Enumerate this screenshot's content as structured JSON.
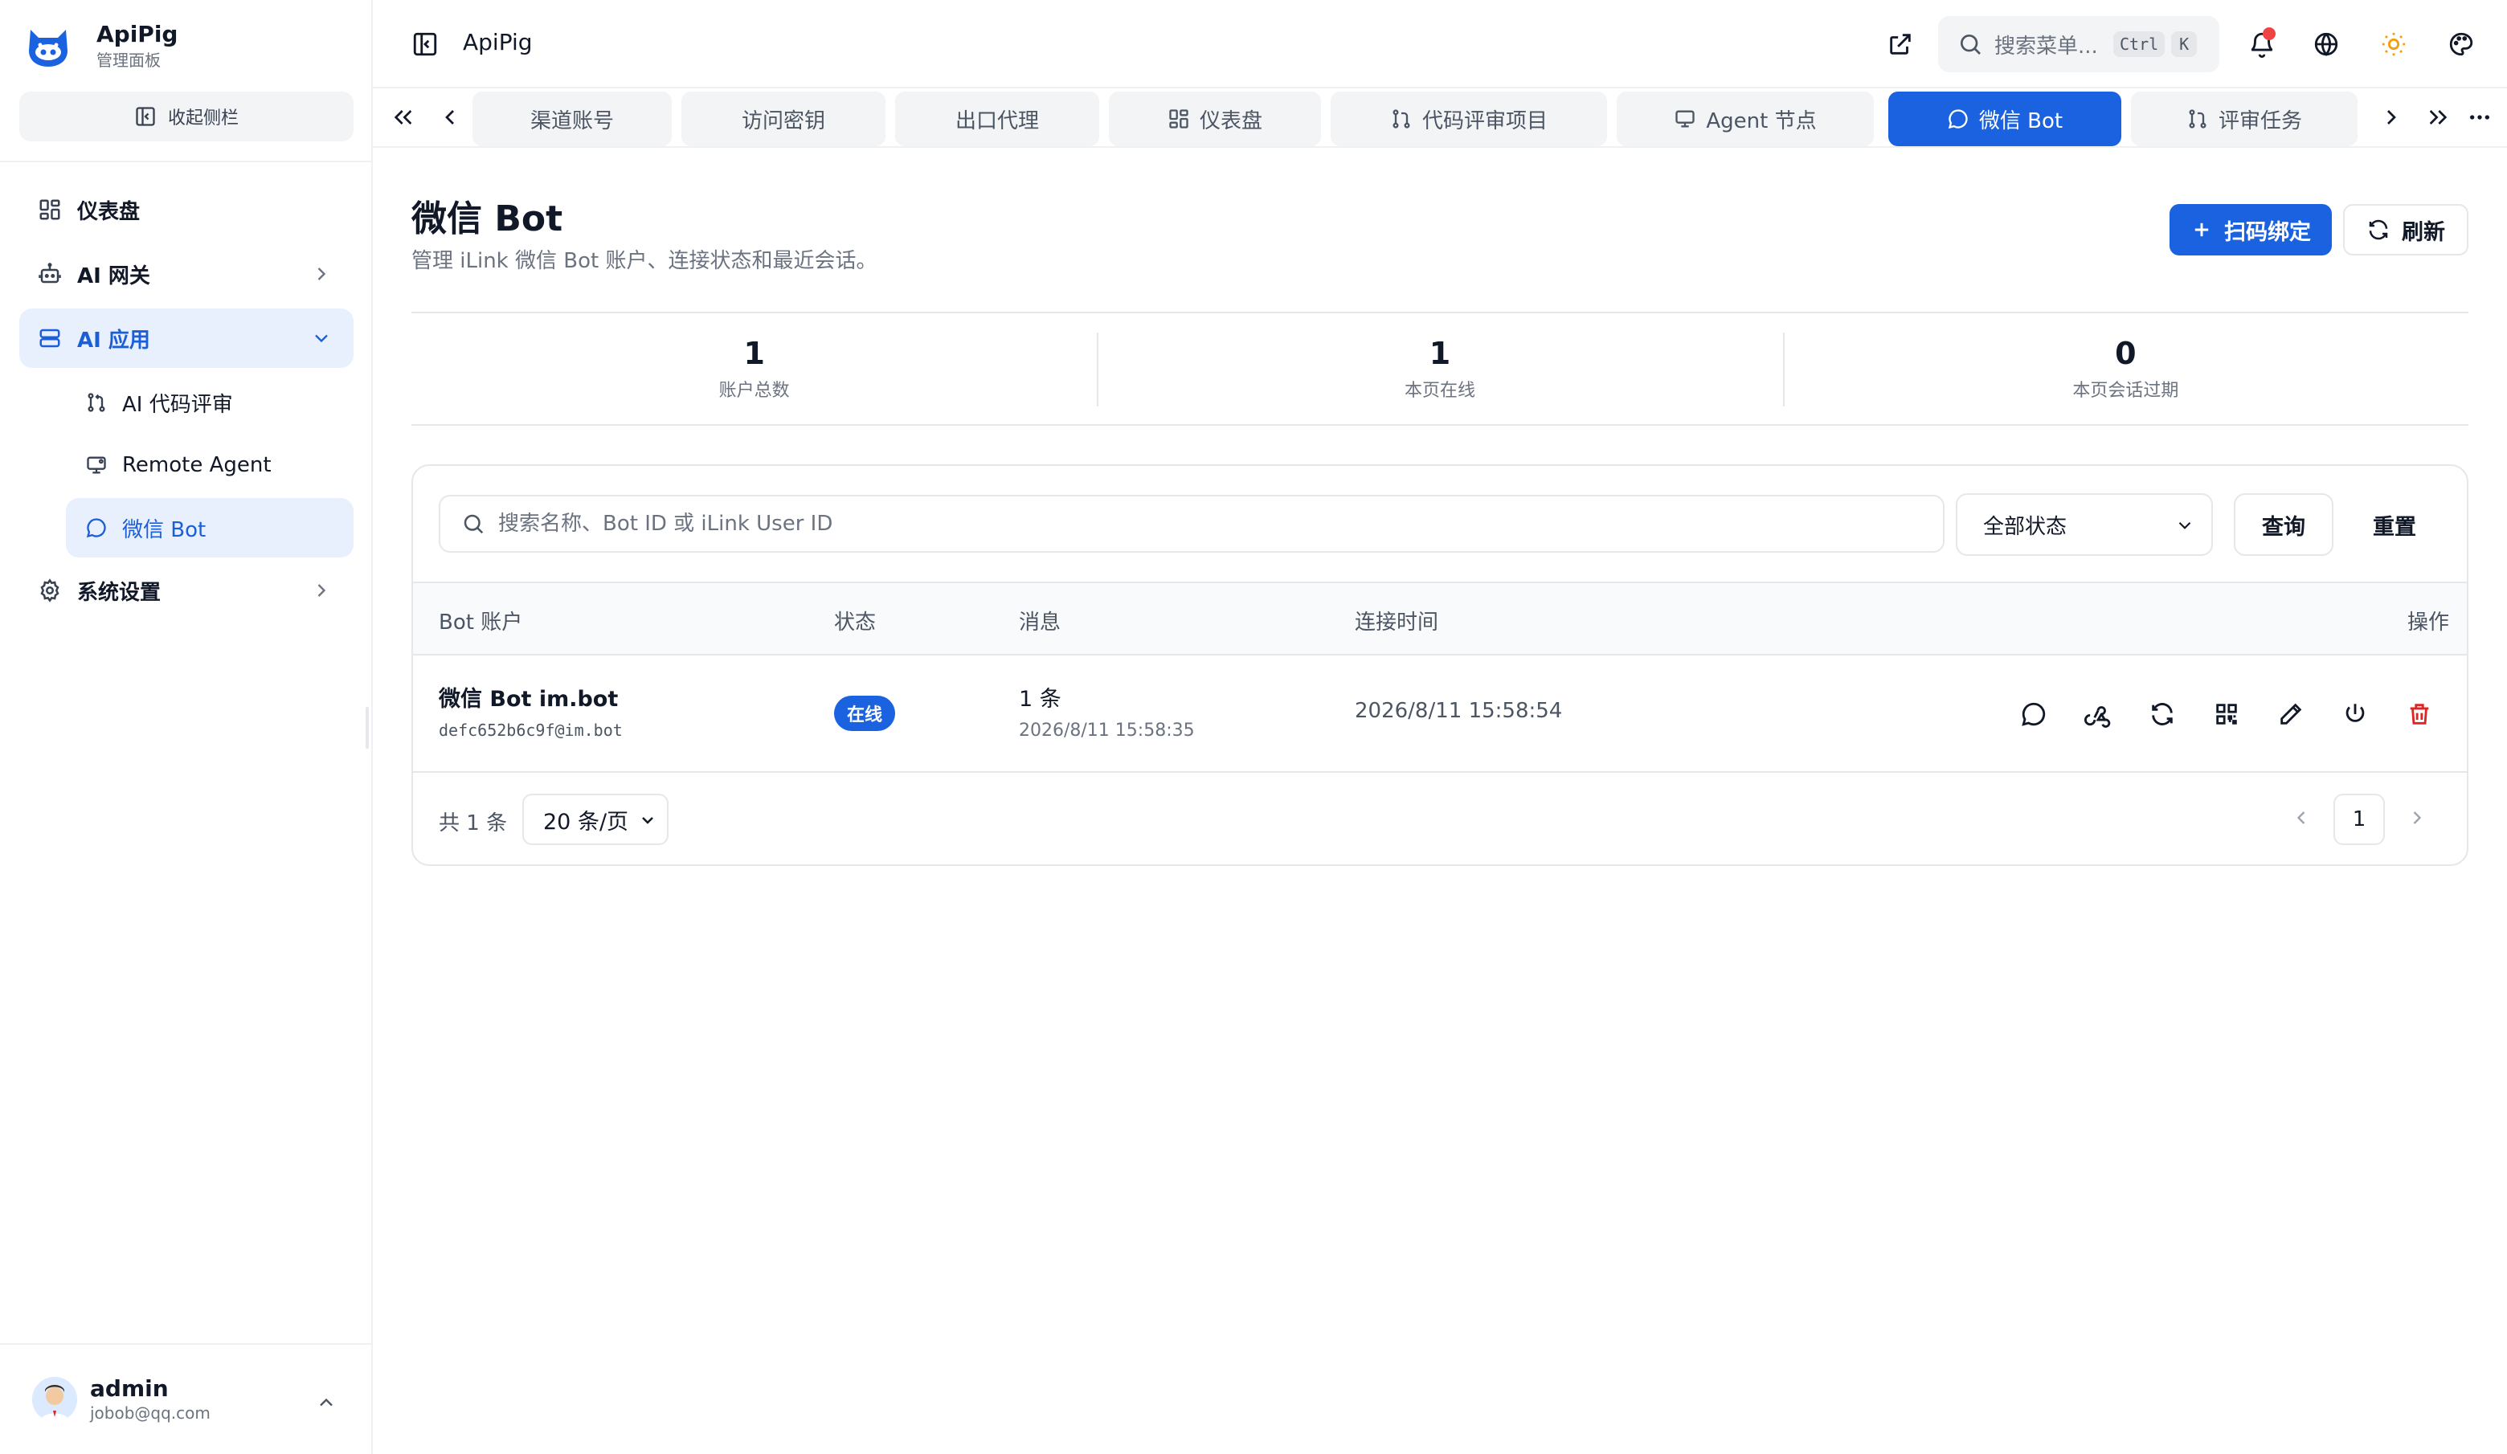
{
  "brand": {
    "title": "ApiPig",
    "subtitle": "管理面板"
  },
  "sidebar": {
    "collapse_label": "收起侧栏",
    "items": [
      {
        "label": "仪表盘",
        "icon": "dashboard-icon"
      },
      {
        "label": "AI 网关",
        "icon": "robot-icon"
      },
      {
        "label": "AI 应用",
        "icon": "server-icon"
      },
      {
        "label": "系统设置",
        "icon": "gear-icon"
      }
    ],
    "sub_items": [
      {
        "label": "AI 代码评审",
        "icon": "git-pull-request-icon"
      },
      {
        "label": "Remote Agent",
        "icon": "monitor-icon"
      },
      {
        "label": "微信 Bot",
        "icon": "chat-bubble-icon"
      }
    ]
  },
  "user": {
    "name": "admin",
    "email": "jobob@qq.com"
  },
  "topbar": {
    "title": "ApiPig",
    "search_placeholder": "搜索菜单...",
    "kbd_ctrl": "Ctrl",
    "kbd_k": "K"
  },
  "tabs": [
    {
      "label": "渠道账号"
    },
    {
      "label": "访问密钥"
    },
    {
      "label": "出口代理"
    },
    {
      "label": "仪表盘"
    },
    {
      "label": "代码评审项目"
    },
    {
      "label": "Agent 节点"
    },
    {
      "label": "微信 Bot"
    },
    {
      "label": "评审任务"
    }
  ],
  "page": {
    "title": "微信 Bot",
    "description": "管理 iLink 微信 Bot 账户、连接状态和最近会话。",
    "bind_button": "扫码绑定",
    "refresh_button": "刷新"
  },
  "stats": [
    {
      "value": "1",
      "label": "账户总数"
    },
    {
      "value": "1",
      "label": "本页在线"
    },
    {
      "value": "0",
      "label": "本页会话过期"
    }
  ],
  "filters": {
    "search_placeholder": "搜索名称、Bot ID 或 iLink User ID",
    "status_selected": "全部状态",
    "query_button": "查询",
    "reset_button": "重置"
  },
  "table": {
    "headers": [
      "Bot 账户",
      "状态",
      "消息",
      "连接时间",
      "操作"
    ],
    "rows": [
      {
        "name": "微信 Bot im.bot",
        "id": "defc652b6c9f@im.bot",
        "status": "在线",
        "msg_count": "1 条",
        "msg_time": "2026/8/11 15:58:35",
        "conn_time": "2026/8/11 15:58:54"
      }
    ]
  },
  "footer": {
    "total": "共 1 条",
    "page_size": "20 条/页",
    "current_page": "1"
  },
  "colors": {
    "accent": "#1a62e0",
    "danger": "#dc2626",
    "active_bg": "#e8f0fe"
  }
}
